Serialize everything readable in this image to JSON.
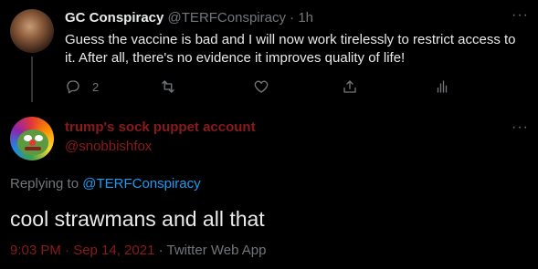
{
  "tweet1": {
    "display_name": "GC Conspiracy",
    "handle": "@TERFConspiracy",
    "separator": "·",
    "time": "1h",
    "text": "Guess the vaccine is bad and I will now work tirelessly to restrict access to it. After all, there's no evidence it improves quality of life!",
    "more": "···",
    "actions": {
      "reply_count": "2",
      "retweet_count": "",
      "like_count": "",
      "share_count": ""
    }
  },
  "tweet2": {
    "display_name": "trump's sock puppet account",
    "handle": "@snobbishfox",
    "more": "···",
    "replying_prefix": "Replying to",
    "replying_to": "@TERFConspiracy",
    "text": "cool strawmans and all that",
    "timestamp": "9:03 PM · Sep 14, 2021",
    "separator": "·",
    "source": "Twitter Web App"
  },
  "colors": {
    "background": "#000000",
    "text_primary": "#e7e9ea",
    "text_secondary": "#71767b",
    "accent": "#1d9bf0",
    "dark_red_highlight": "#8b1a1a"
  },
  "icons": {
    "reply": "reply-icon",
    "retweet": "retweet-icon",
    "like": "heart-icon",
    "share": "share-icon",
    "analytics": "analytics-icon",
    "more": "more-icon"
  }
}
